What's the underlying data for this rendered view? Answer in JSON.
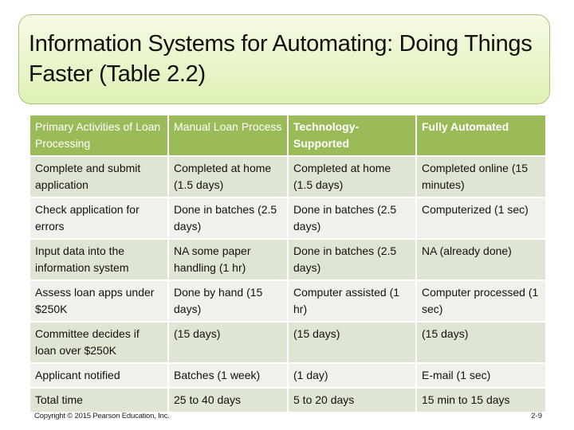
{
  "slide": {
    "title": "Information Systems for Automating: Doing Things Faster (Table 2.2)",
    "colors": {
      "header_fill": "#9bbb59",
      "row_dark": "#dfe5d3",
      "row_light": "#eff2ea",
      "title_box": "#e6f4c8"
    }
  },
  "table": {
    "headers": [
      "Primary Activities of Loan Processing",
      "Manual Loan Process",
      "Technology-Supported",
      "Fully Automated"
    ],
    "rows": [
      [
        "Complete and submit application",
        "Completed at home (1.5 days)",
        "Completed at home (1.5 days)",
        "Completed online (15 minutes)"
      ],
      [
        "Check application for errors",
        "Done in batches (2.5 days)",
        "Done in batches (2.5 days)",
        "Computerized (1 sec)"
      ],
      [
        "Input data into the information system",
        "NA some paper handling (1 hr)",
        "Done in batches (2.5 days)",
        "NA (already done)"
      ],
      [
        "Assess loan apps under $250K",
        "Done by hand (15 days)",
        "Computer assisted (1 hr)",
        "Computer processed (1 sec)"
      ],
      [
        "Committee decides if loan over $250K",
        "(15 days)",
        "(15 days)",
        "(15 days)"
      ],
      [
        "Applicant notified",
        "Batches (1 week)",
        "(1 day)",
        "E-mail (1 sec)"
      ],
      [
        "Total time",
        "25 to 40 days",
        "5 to 20 days",
        "15 min to 15 days"
      ]
    ]
  },
  "footer": {
    "copyright": "Copyright © 2015 Pearson Education, Inc.",
    "page_number": "2-9"
  }
}
